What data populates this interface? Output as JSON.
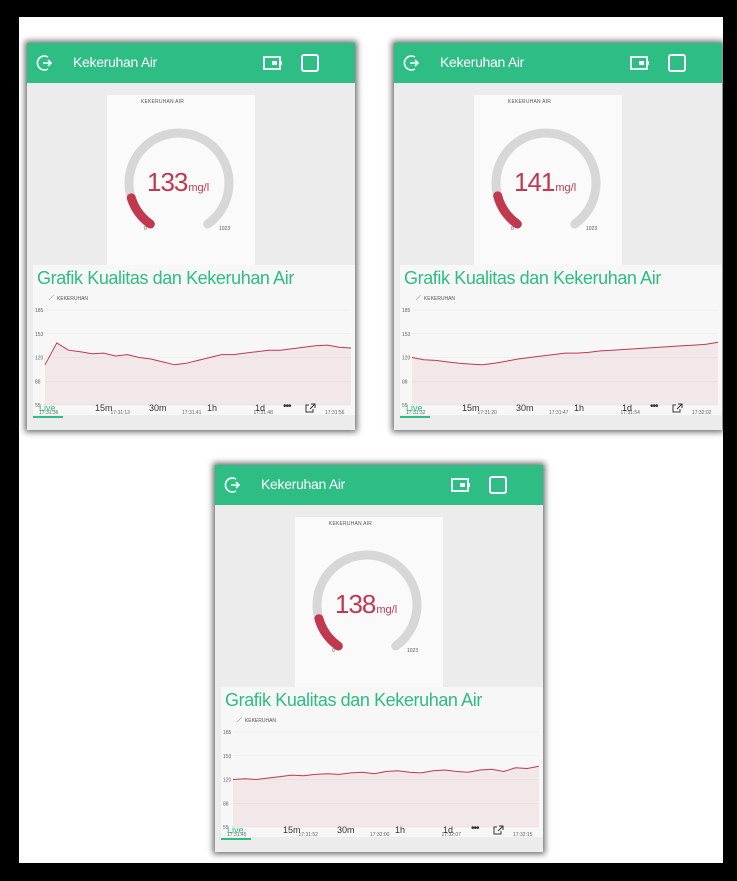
{
  "colors": {
    "accent": "#2ebd85",
    "gauge_fill": "#c0394f",
    "gauge_track": "#d7d7d7",
    "line": "#c0394f"
  },
  "panels": [
    {
      "header": {
        "title": "Kekeruhan Air"
      },
      "gauge": {
        "label": "KEKERUHAN AIR",
        "value": "133",
        "unit": "mg/l",
        "min": "0",
        "max": "1023",
        "fraction": 0.13
      },
      "chart": {
        "title": "Grafik Kualitas dan Kekeruhan Air",
        "legend": "KEKERUHAN",
        "y_ticks": [
          "185",
          "153",
          "120",
          "88",
          "55"
        ],
        "x_ticks": [
          "17:31:36",
          "17:31:13",
          "17:31:41",
          "17:31:48",
          "17:31:56"
        ]
      },
      "tabs": {
        "live": "Live",
        "t15m": "15m",
        "t30m": "30m",
        "t1h": "1h",
        "t1d": "1d",
        "more": "•••"
      }
    },
    {
      "header": {
        "title": "Kekeruhan Air"
      },
      "gauge": {
        "label": "KEKERUHAN AIR",
        "value": "141",
        "unit": "mg/l",
        "min": "0",
        "max": "1023",
        "fraction": 0.138
      },
      "chart": {
        "title": "Grafik Kualitas dan Kekeruhan Air",
        "legend": "KEKERUHAN",
        "y_ticks": [
          "185",
          "153",
          "120",
          "88",
          "55"
        ],
        "x_ticks": [
          "17:31:32",
          "17:31:20",
          "17:31:47",
          "17:31:54",
          "17:32:02"
        ]
      },
      "tabs": {
        "live": "Live",
        "t15m": "15m",
        "t30m": "30m",
        "t1h": "1h",
        "t1d": "1d",
        "more": "•••"
      }
    },
    {
      "header": {
        "title": "Kekeruhan Air"
      },
      "gauge": {
        "label": "KEKERUHAN AIR",
        "value": "138",
        "unit": "mg/l",
        "min": "0",
        "max": "1023",
        "fraction": 0.135
      },
      "chart": {
        "title": "Grafik Kualitas dan Kekeruhan Air",
        "legend": "KEKERUHAN",
        "y_ticks": [
          "185",
          "153",
          "120",
          "88",
          "55"
        ],
        "x_ticks": [
          "17:31:45",
          "17:31:52",
          "17:32:00",
          "17:32:07",
          "17:32:15"
        ]
      },
      "tabs": {
        "live": "Live",
        "t15m": "15m",
        "t30m": "30m",
        "t1h": "1h",
        "t1d": "1d",
        "more": "•••"
      }
    }
  ],
  "chart_data": [
    {
      "type": "area",
      "title": "Grafik Kualitas dan Kekeruhan Air",
      "series": [
        {
          "name": "KEKERUHAN",
          "values": [
            110,
            140,
            130,
            128,
            125,
            126,
            122,
            124,
            120,
            118,
            114,
            110,
            112,
            116,
            120,
            124,
            124,
            126,
            128,
            130,
            130,
            132,
            134,
            136,
            137,
            134,
            133
          ]
        }
      ],
      "ylim": [
        55,
        185
      ]
    },
    {
      "type": "area",
      "title": "Grafik Kualitas dan Kekeruhan Air",
      "series": [
        {
          "name": "KEKERUHAN",
          "values": [
            120,
            117,
            116,
            114,
            112,
            111,
            110,
            112,
            115,
            118,
            120,
            122,
            124,
            126,
            126,
            127,
            129,
            130,
            131,
            132,
            133,
            134,
            135,
            136,
            137,
            138,
            141
          ]
        }
      ],
      "ylim": [
        55,
        185
      ]
    },
    {
      "type": "area",
      "title": "Grafik Kualitas dan Kekeruhan Air",
      "series": [
        {
          "name": "KEKERUHAN",
          "values": [
            120,
            121,
            120,
            122,
            124,
            126,
            125,
            127,
            128,
            127,
            129,
            130,
            128,
            131,
            132,
            130,
            129,
            132,
            133,
            131,
            130,
            133,
            134,
            131,
            136,
            135,
            138
          ]
        }
      ],
      "ylim": [
        55,
        185
      ]
    }
  ]
}
